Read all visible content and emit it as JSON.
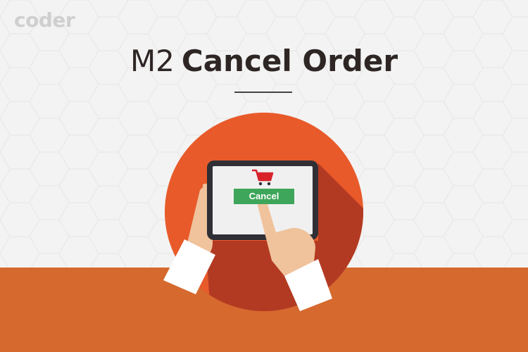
{
  "logo": {
    "text": "coder"
  },
  "title": {
    "prefix": "M2",
    "main": "Cancel Order"
  },
  "screen": {
    "button_label": "Cancel",
    "icon": "shopping-cart-icon"
  },
  "colors": {
    "background": "#f2f2f2",
    "bottom_band": "#d5692e",
    "circle": "#e85a2a",
    "circle_shadow": "#b33a22",
    "tablet_frame": "#2f2f35",
    "tablet_screen": "#f0f0f0",
    "button": "#3ea65a",
    "cart": "#d8232a",
    "skin": "#f0c39c",
    "cuff": "#ffffff"
  }
}
